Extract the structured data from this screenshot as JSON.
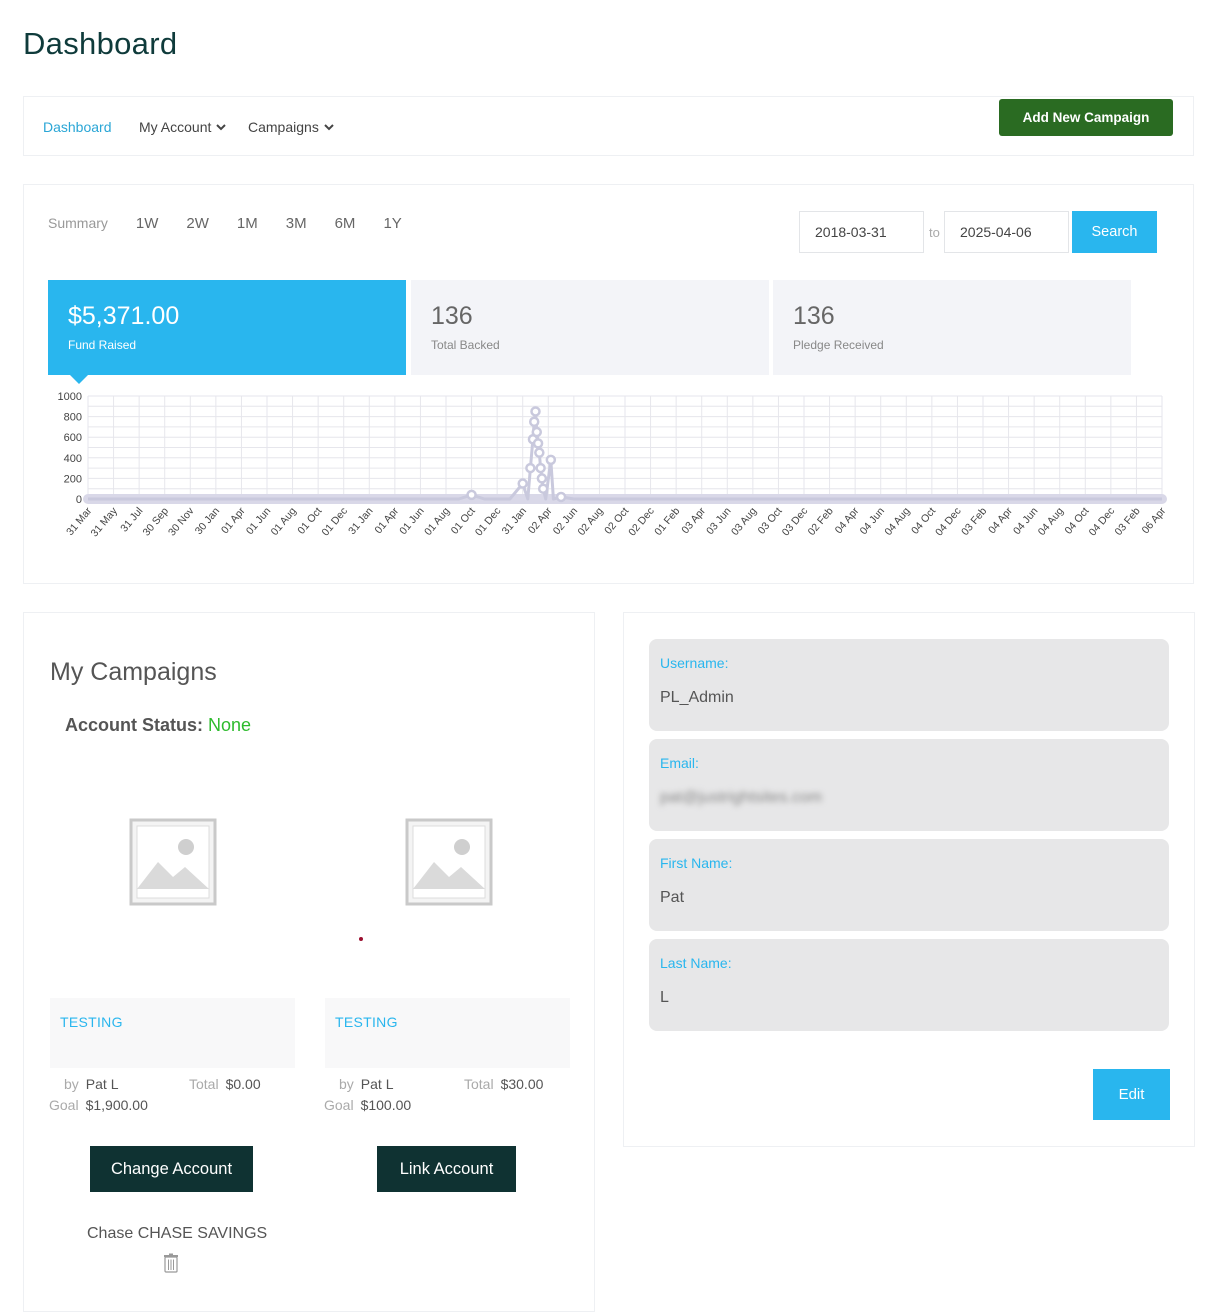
{
  "page": {
    "title": "Dashboard"
  },
  "nav": {
    "items": [
      {
        "label": "Dashboard",
        "active": true,
        "dropdown": false
      },
      {
        "label": "My Account",
        "active": false,
        "dropdown": true
      },
      {
        "label": "Campaigns",
        "active": false,
        "dropdown": true
      }
    ],
    "add_campaign_label": "Add New Campaign",
    "add_campaign_color": "#2a6b22"
  },
  "summary": {
    "tabs": [
      "Summary",
      "1W",
      "2W",
      "1M",
      "3M",
      "6M",
      "1Y"
    ],
    "date_from": "2018-03-31",
    "date_to_label": "to",
    "date_to": "2025-04-06",
    "search_label": "Search",
    "accent_color": "#29b6ee",
    "stats": [
      {
        "value": "$5,371.00",
        "label": "Fund Raised",
        "active": true
      },
      {
        "value": "136",
        "label": "Total Backed",
        "active": false
      },
      {
        "value": "136",
        "label": "Pledge Received",
        "active": false
      }
    ]
  },
  "chart_data": {
    "type": "line",
    "ylim": [
      0,
      1000
    ],
    "yticks": [
      0,
      200,
      400,
      600,
      800,
      1000
    ],
    "grid": true,
    "xlabels": [
      "31 Mar",
      "31 May",
      "31 Jul",
      "30 Sep",
      "30 Nov",
      "30 Jan",
      "01 Apr",
      "01 Jun",
      "01 Aug",
      "01 Oct",
      "01 Dec",
      "31 Jan",
      "01 Apr",
      "01 Jun",
      "01 Aug",
      "01 Oct",
      "01 Dec",
      "31 Jan",
      "02 Apr",
      "02 Jun",
      "02 Aug",
      "02 Oct",
      "02 Dec",
      "01 Feb",
      "03 Apr",
      "03 Jun",
      "03 Aug",
      "03 Oct",
      "03 Dec",
      "02 Feb",
      "04 Apr",
      "04 Jun",
      "04 Aug",
      "04 Oct",
      "04 Dec",
      "03 Feb",
      "04 Apr",
      "04 Jun",
      "04 Aug",
      "04 Oct",
      "04 Dec",
      "03 Feb",
      "06 Apr"
    ],
    "series": [
      {
        "color": "#c9c9dd",
        "points": [
          {
            "x": 0,
            "y": 0
          },
          {
            "x": 14.5,
            "y": 0
          },
          {
            "x": 15,
            "y": 40
          },
          {
            "x": 15.5,
            "y": 0
          },
          {
            "x": 16.5,
            "y": 0
          },
          {
            "x": 17,
            "y": 150
          },
          {
            "x": 17.2,
            "y": 0
          },
          {
            "x": 17.3,
            "y": 300
          },
          {
            "x": 17.4,
            "y": 580
          },
          {
            "x": 17.45,
            "y": 750
          },
          {
            "x": 17.5,
            "y": 850
          },
          {
            "x": 17.55,
            "y": 650
          },
          {
            "x": 17.6,
            "y": 540
          },
          {
            "x": 17.65,
            "y": 450
          },
          {
            "x": 17.7,
            "y": 300
          },
          {
            "x": 17.75,
            "y": 200
          },
          {
            "x": 17.8,
            "y": 100
          },
          {
            "x": 17.9,
            "y": 0
          },
          {
            "x": 18.1,
            "y": 380
          },
          {
            "x": 18.2,
            "y": 0
          },
          {
            "x": 18.5,
            "y": 20
          },
          {
            "x": 19,
            "y": 0
          },
          {
            "x": 42,
            "y": 0
          }
        ]
      }
    ]
  },
  "campaigns": {
    "title": "My Campaigns",
    "account_status_label": "Account Status:",
    "account_status_value": "None",
    "status_color": "#2dbb2d",
    "items": [
      {
        "name": "TESTING",
        "by_label": "by",
        "by": "Pat L",
        "total_label": "Total",
        "total": "$0.00",
        "goal_label": "Goal",
        "goal": "$1,900.00"
      },
      {
        "name": "TESTING",
        "by_label": "by",
        "by": "Pat L",
        "total_label": "Total",
        "total": "$30.00",
        "goal_label": "Goal",
        "goal": "$100.00"
      }
    ],
    "change_account_label": "Change Account",
    "link_account_label": "Link Account",
    "bank_name": "Chase CHASE SAVINGS"
  },
  "profile": {
    "fields": [
      {
        "label": "Username:",
        "value": "PL_Admin",
        "blurred": false
      },
      {
        "label": "Email:",
        "value": "pat@justrightsites.com",
        "blurred": true
      },
      {
        "label": "First Name:",
        "value": "Pat",
        "blurred": false
      },
      {
        "label": "Last Name:",
        "value": "L",
        "blurred": false
      }
    ],
    "edit_label": "Edit"
  }
}
